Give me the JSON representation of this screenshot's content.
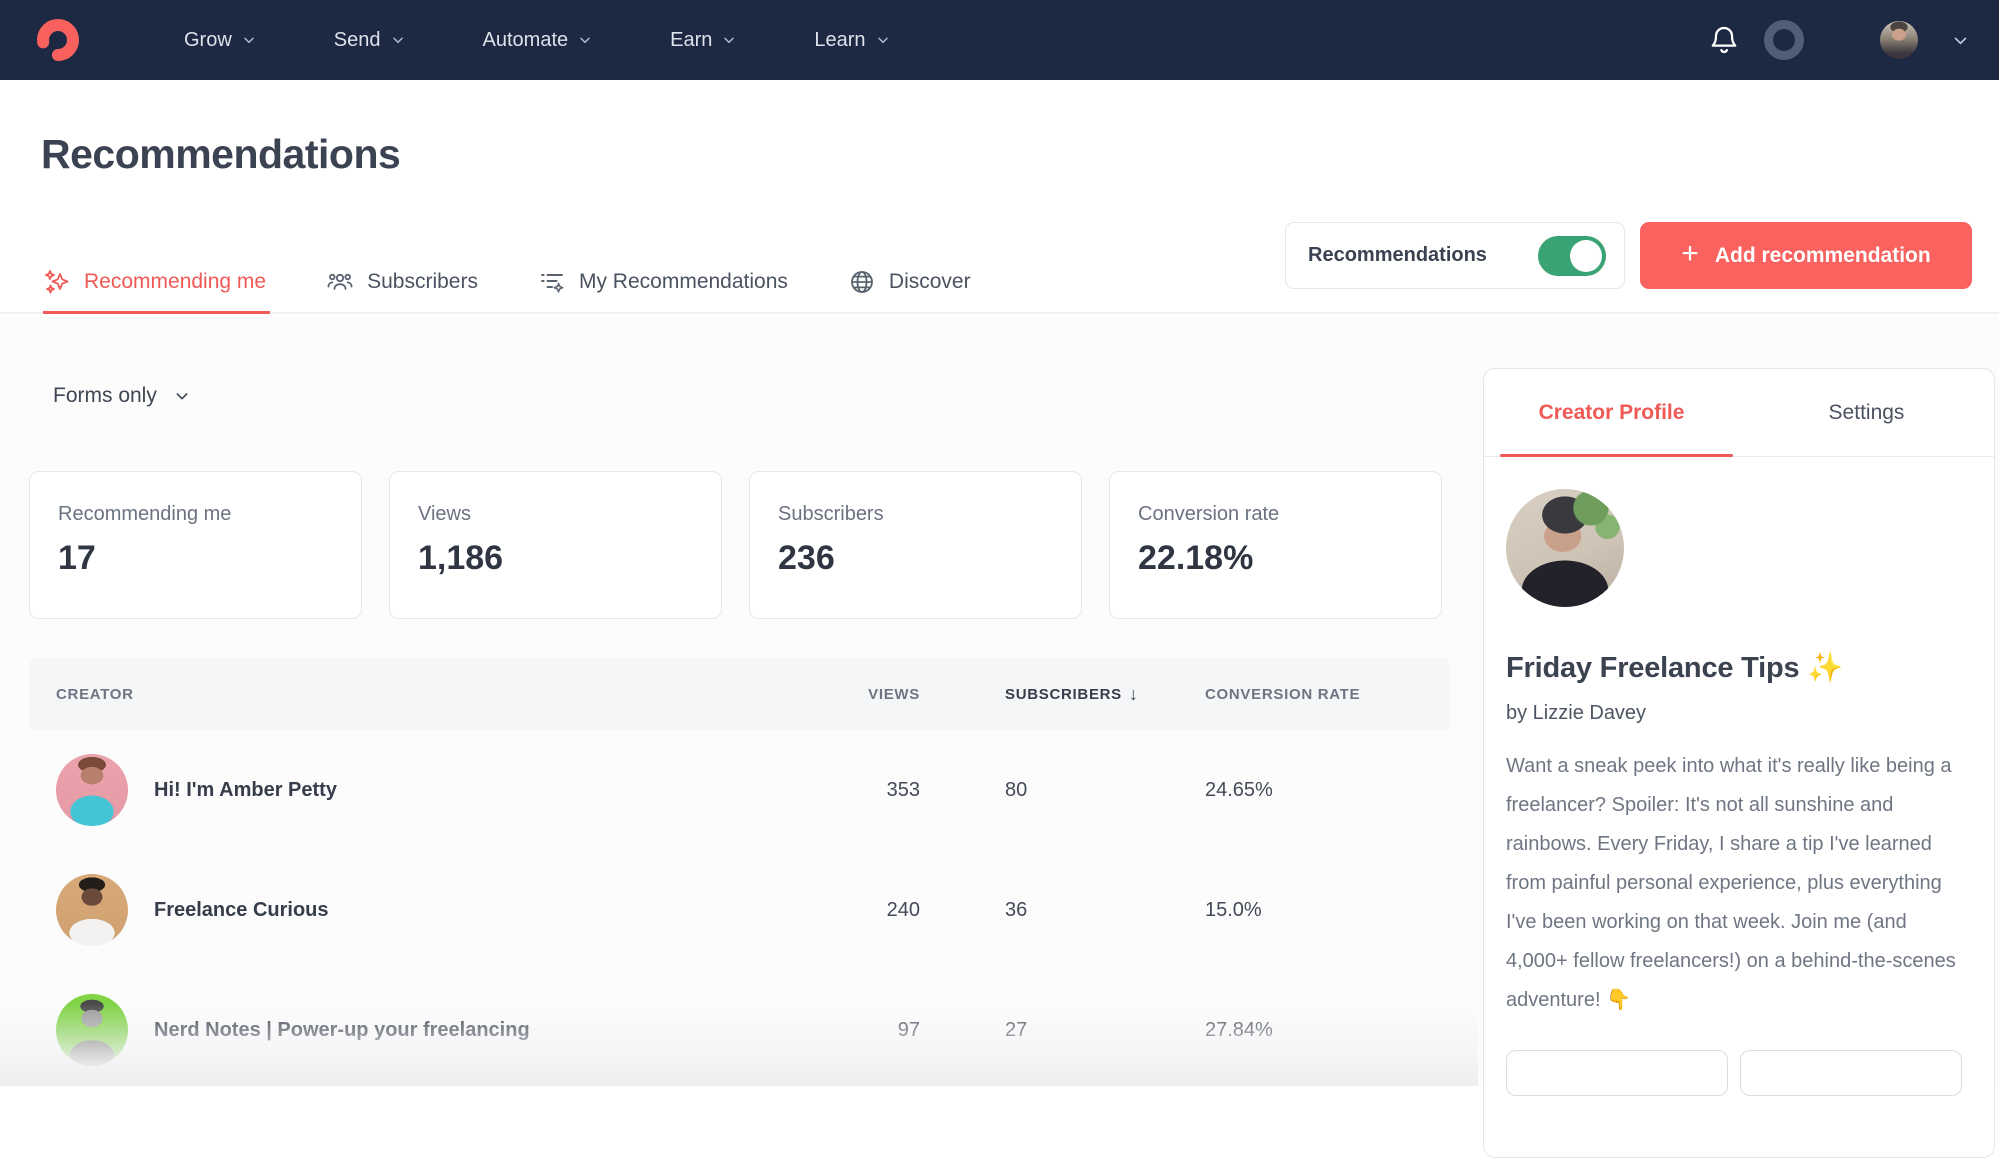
{
  "brand": {
    "coral": "#f9615e",
    "navy": "#1d2942",
    "green": "#3aa374"
  },
  "nav": {
    "items": [
      {
        "label": "Grow"
      },
      {
        "label": "Send"
      },
      {
        "label": "Automate"
      },
      {
        "label": "Earn"
      },
      {
        "label": "Learn"
      }
    ],
    "icons": {
      "logo": "convertkit-swoosh",
      "bell": "bell",
      "status_ring": "ring",
      "avatar_caret": "chevron-down"
    }
  },
  "page": {
    "title": "Recommendations"
  },
  "tabs": [
    {
      "label": "Recommending me",
      "icon": "sparkles",
      "active": true
    },
    {
      "label": "Subscribers",
      "icon": "people-group",
      "active": false
    },
    {
      "label": "My Recommendations",
      "icon": "list-sparkle",
      "active": false
    },
    {
      "label": "Discover",
      "icon": "globe",
      "active": false
    }
  ],
  "actions": {
    "toggle_label": "Recommendations",
    "toggle_state": "on",
    "add_button_label": "Add recommendation",
    "add_button_icon": "+"
  },
  "filter": {
    "value": "Forms only",
    "icon": "chevron-down"
  },
  "stats": [
    {
      "label": "Recommending me",
      "value": "17"
    },
    {
      "label": "Views",
      "value": "1,186"
    },
    {
      "label": "Subscribers",
      "value": "236"
    },
    {
      "label": "Conversion rate",
      "value": "22.18%"
    }
  ],
  "table": {
    "columns": {
      "creator": "CREATOR",
      "views": "VIEWS",
      "subscribers": "SUBSCRIBERS",
      "conversion": "CONVERSION RATE"
    },
    "sort": {
      "column": "SUBSCRIBERS",
      "direction": "desc",
      "indicator": "↓"
    },
    "rows": [
      {
        "creator": "Hi! I'm Amber Petty",
        "views": "353",
        "subscribers": "80",
        "conversion": "24.65%"
      },
      {
        "creator": "Freelance Curious",
        "views": "240",
        "subscribers": "36",
        "conversion": "15.0%"
      },
      {
        "creator": "Nerd Notes | Power-up your freelancing",
        "views": "97",
        "subscribers": "27",
        "conversion": "27.84%"
      }
    ]
  },
  "panel": {
    "tabs": [
      {
        "label": "Creator Profile",
        "active": true
      },
      {
        "label": "Settings",
        "active": false
      }
    ],
    "profile": {
      "title": "Friday Freelance Tips ✨",
      "author": "by Lizzie Davey",
      "description": "Want a sneak peek into what it's really like being a freelancer? Spoiler: It's not all sunshine and rainbows. Every Friday, I share a tip I've learned from painful personal experience, plus everything I've been working on that week. Join me (and 4,000+ fellow freelancers!) on a behind-the-scenes adventure! 👇"
    }
  }
}
